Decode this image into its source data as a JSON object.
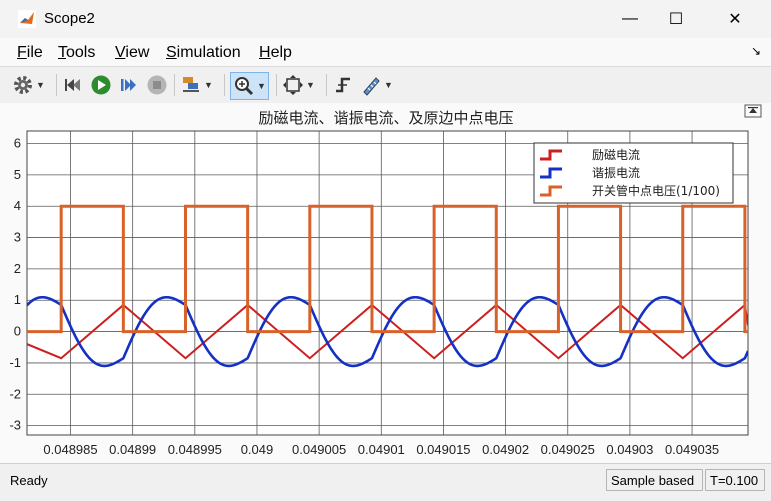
{
  "window": {
    "title": "Scope2",
    "minimize_glyph": "—",
    "maximize_glyph": "☐",
    "close_glyph": "✕"
  },
  "menu": {
    "items": [
      {
        "label": "File",
        "key": "F",
        "rest": "ile"
      },
      {
        "label": "Tools",
        "key": "T",
        "rest": "ools"
      },
      {
        "label": "View",
        "key": "V",
        "rest": "iew"
      },
      {
        "label": "Simulation",
        "key": "S",
        "rest": "imulation"
      },
      {
        "label": "Help",
        "key": "H",
        "rest": "elp"
      }
    ],
    "dock_glyph": "↘"
  },
  "toolbar": {
    "icons": [
      "gear-icon",
      "step-back-icon",
      "run-icon",
      "step-forward-icon",
      "stop-icon",
      "signal-select-icon",
      "zoom-icon",
      "autoscale-icon",
      "triggers-icon",
      "measurements-icon"
    ]
  },
  "plot": {
    "title": "励磁电流、谐振电流、及原边中点电压",
    "undock_glyph": "⊼"
  },
  "chart_data": {
    "type": "line",
    "title": "励磁电流、谐振电流、及原边中点电压",
    "xlabel": "",
    "ylabel": "",
    "xlim": [
      0.0489815,
      0.0490395
    ],
    "ylim": [
      -3.3,
      6.4
    ],
    "grid": true,
    "legend_position": "top-right",
    "x_ticks": [
      0.048985,
      0.04899,
      0.048995,
      0.049,
      0.049005,
      0.04901,
      0.049015,
      0.04902,
      0.049025,
      0.04903,
      0.049035
    ],
    "x_tick_labels": [
      "0.048985",
      "0.04899",
      "0.048995",
      "0.049",
      "0.049005",
      "0.04901",
      "0.049015",
      "0.04902",
      "0.049025",
      "0.04903",
      "0.049035"
    ],
    "y_ticks": [
      -3,
      -2,
      -1,
      0,
      1,
      2,
      3,
      4,
      5,
      6
    ],
    "y_tick_labels": [
      "-3",
      "-2",
      "-1",
      "0",
      "1",
      "2",
      "3",
      "4",
      "5",
      "6"
    ],
    "series": [
      {
        "name": "励磁电流",
        "color": "#cc1f1f",
        "shape": "triangle",
        "x": [
          0.0489815,
          0.04898425,
          0.04898925,
          0.04899425,
          0.04899925,
          0.04900425,
          0.04900925,
          0.04901425,
          0.04901925,
          0.04902425,
          0.04902925,
          0.04903425,
          0.04903925,
          0.0490395
        ],
        "y": [
          -0.4,
          -0.85,
          0.85,
          -0.85,
          0.85,
          -0.85,
          0.85,
          -0.85,
          0.85,
          -0.85,
          0.85,
          -0.85,
          0.85,
          0.2
        ]
      },
      {
        "name": "谐振电流",
        "color": "#1431c4",
        "shape": "resonant",
        "period": 1e-05,
        "rise_start_offset": 2.75e-06,
        "rise_peak_offset": 5.25e-06,
        "peak": 1.95,
        "trough": -1.95,
        "base": 0.85
      },
      {
        "name": "开关管中点电压(1/100)",
        "color": "#d9622b",
        "shape": "square",
        "high": 4,
        "low": 0,
        "high_intervals": [
          [
            0.04898425,
            0.04898925
          ],
          [
            0.04899425,
            0.04899925
          ],
          [
            0.04900425,
            0.04900925
          ],
          [
            0.04901425,
            0.04901925
          ],
          [
            0.04902425,
            0.04902925
          ],
          [
            0.04903425,
            0.04903925
          ]
        ]
      }
    ]
  },
  "status": {
    "ready": "Ready",
    "sample": "Sample based",
    "time": "T=0.100"
  }
}
